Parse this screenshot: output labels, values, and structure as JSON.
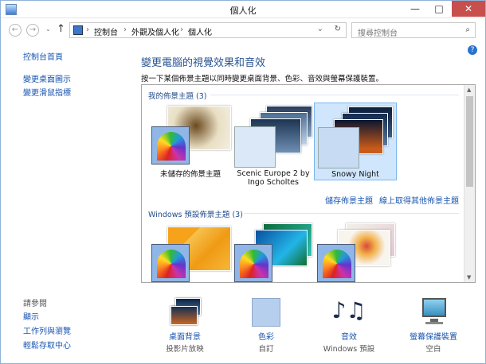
{
  "window": {
    "title": "個人化",
    "minimize": "—",
    "maximize": "□",
    "close": "✕"
  },
  "address": {
    "crumbs": [
      "控制台",
      "外觀及個人化",
      "個人化"
    ],
    "separator": "›",
    "search_placeholder": "搜尋控制台"
  },
  "sidebar": {
    "home": "控制台首頁",
    "items": [
      "變更桌面圖示",
      "變更滑鼠指標"
    ],
    "see_also_title": "請參閱",
    "see_also": [
      "顯示",
      "工作列與瀏覽",
      "輕鬆存取中心"
    ]
  },
  "main": {
    "title": "變更電腦的視覺效果和音效",
    "description": "按一下某個佈景主題以同時變更桌面背景、色彩、音效與螢幕保護裝置。"
  },
  "themes": {
    "my_header": "我的佈景主題 (3)",
    "my": [
      {
        "name": "未儲存的佈景主題"
      },
      {
        "name": "Scenic Europe 2 by Ingo Scholtes"
      },
      {
        "name": "Snowy Night"
      }
    ],
    "save_link": "儲存佈景主題",
    "online_link": "線上取得其他佈景主題",
    "windows_header": "Windows 預設佈景主題 (3)"
  },
  "bottom": [
    {
      "label": "桌面背景",
      "sub": "投影片放映"
    },
    {
      "label": "色彩",
      "sub": "自訂"
    },
    {
      "label": "音效",
      "sub": "Windows 預設"
    },
    {
      "label": "螢幕保護裝置",
      "sub": "空白"
    }
  ],
  "colors": {
    "accent": "#1a56b0",
    "heading": "#2b5592",
    "selection": "#cfe6fd"
  }
}
